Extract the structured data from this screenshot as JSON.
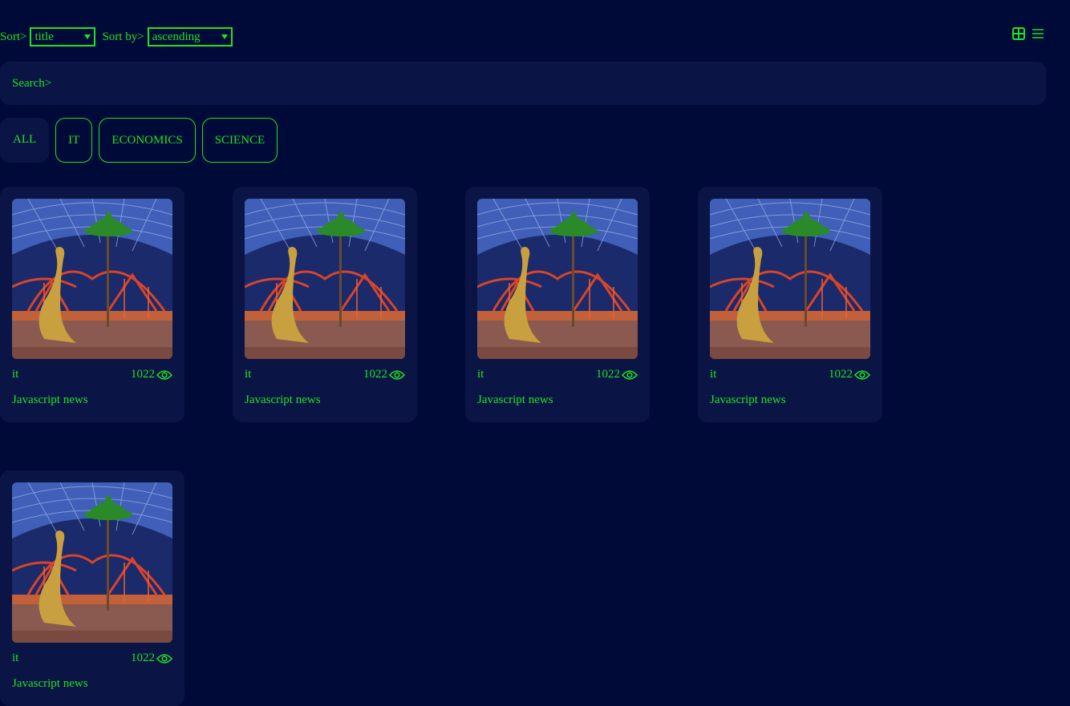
{
  "controls": {
    "sort_label": "Sort>",
    "sort_value": "title",
    "sortby_label": "Sort by>",
    "sortby_value": "ascending"
  },
  "view_toggle": {
    "grid_icon": "grid-icon",
    "list_icon": "list-icon"
  },
  "search": {
    "placeholder": "Search>"
  },
  "tabs": [
    {
      "label": "ALL"
    },
    {
      "label": "IT"
    },
    {
      "label": "ECONOMICS"
    },
    {
      "label": "SCIENCE"
    }
  ],
  "cards": [
    {
      "category": "it",
      "views": "1022",
      "title": "Javascript news"
    },
    {
      "category": "it",
      "views": "1022",
      "title": "Javascript news"
    },
    {
      "category": "it",
      "views": "1022",
      "title": "Javascript news"
    },
    {
      "category": "it",
      "views": "1022",
      "title": "Javascript news"
    },
    {
      "category": "it",
      "views": "1022",
      "title": "Javascript news"
    }
  ],
  "colors": {
    "background": "#000a38",
    "panel": "#0a1545",
    "accent": "#22e022"
  }
}
